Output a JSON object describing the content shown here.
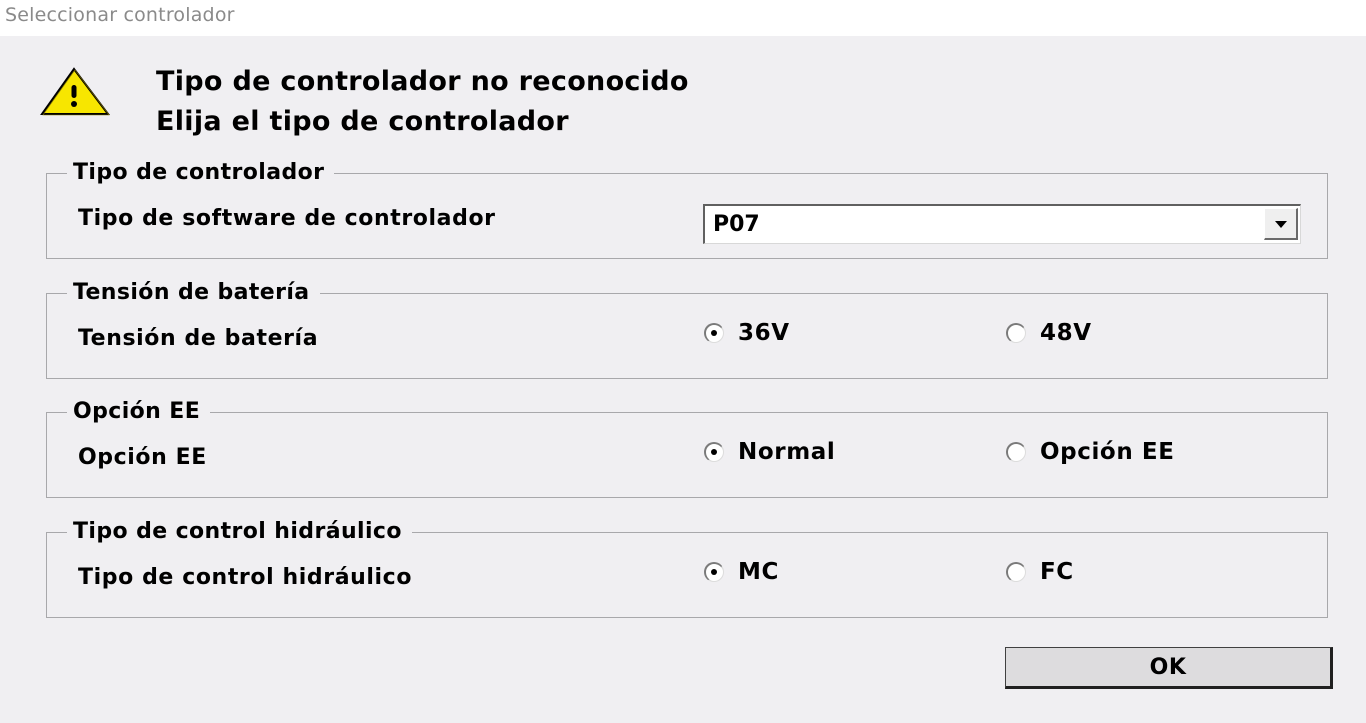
{
  "window": {
    "title": "Seleccionar controlador"
  },
  "message": {
    "icon": "warning-icon",
    "line1": "Tipo de controlador no reconocido",
    "line2": "Elija el tipo de controlador"
  },
  "groups": {
    "controller_type": {
      "legend": "Tipo de controlador",
      "label": "Tipo de software de controlador",
      "selected_value": "P07"
    },
    "battery": {
      "legend": "Tensión de batería",
      "label": "Tensión de batería",
      "options": [
        {
          "label": "36V",
          "checked": true
        },
        {
          "label": "48V",
          "checked": false
        }
      ]
    },
    "ee_option": {
      "legend": "Opción EE",
      "label": "Opción EE",
      "options": [
        {
          "label": "Normal",
          "checked": true
        },
        {
          "label": "Opción EE",
          "checked": false
        }
      ]
    },
    "hydraulic": {
      "legend": "Tipo de control hidráulico",
      "label": "Tipo de control hidráulico",
      "options": [
        {
          "label": "MC",
          "checked": true
        },
        {
          "label": "FC",
          "checked": false
        }
      ]
    }
  },
  "buttons": {
    "ok_label": "OK"
  }
}
